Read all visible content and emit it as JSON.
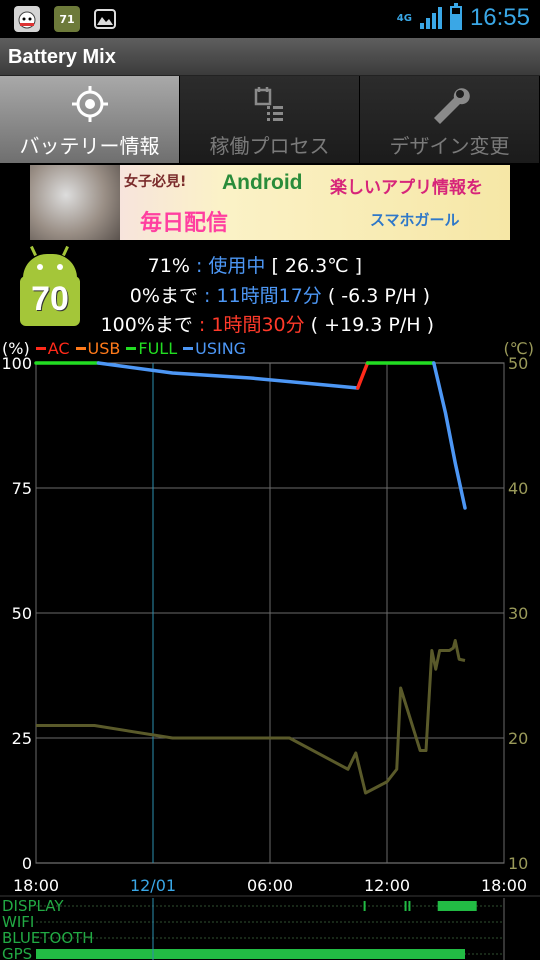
{
  "status_bar": {
    "time": "16:55",
    "network": "4G",
    "notification_badge": "71"
  },
  "app": {
    "title": "Battery Mix"
  },
  "tabs": [
    {
      "label": "バッテリー情報",
      "icon": "target-icon",
      "active": true
    },
    {
      "label": "稼働プロセス",
      "icon": "process-list-icon",
      "active": false
    },
    {
      "label": "デザイン変更",
      "icon": "wrench-icon",
      "active": false
    }
  ],
  "banner": {
    "tag": "女子必見!",
    "main": "Android",
    "main2": "楽しいアプリ情報を",
    "sub": "毎日配信",
    "sub2": "スマホガール"
  },
  "battery": {
    "level": "70",
    "line1": {
      "percent": "71%",
      "sep": " : ",
      "state": "使用中",
      "temp": " [ 26.3℃ ]"
    },
    "line2": {
      "label": "0%まで",
      "sep": " : ",
      "time": "11時間17分",
      "rate": " ( -6.3 P/H )"
    },
    "line3": {
      "label": "100%まで",
      "sep": " : ",
      "time": "1時間30分",
      "rate": " ( +19.3 P/H )"
    }
  },
  "chart_data": {
    "type": "line",
    "left_axis_label": "(%)",
    "right_axis_label": "(℃)",
    "legend": [
      {
        "name": "AC",
        "color": "#ff2a1a"
      },
      {
        "name": "USB",
        "color": "#ff7a1a"
      },
      {
        "name": "FULL",
        "color": "#22dd22"
      },
      {
        "name": "USING",
        "color": "#4d97f5"
      }
    ],
    "y_left_ticks": [
      "100",
      "75",
      "50",
      "25",
      "0"
    ],
    "y_right_ticks": [
      "50",
      "40",
      "30",
      "20",
      "10"
    ],
    "ylim_left": [
      0,
      100
    ],
    "ylim_right": [
      10,
      50
    ],
    "x_ticks": [
      "18:00",
      "12/01",
      "06:00",
      "12:00",
      "18:00"
    ],
    "x_ticks_hours": [
      0,
      6,
      12,
      18,
      24
    ],
    "xlim_hours": [
      0,
      24
    ],
    "battery_series": [
      {
        "state": "FULL",
        "color": "#22dd22",
        "points": [
          [
            0,
            100
          ],
          [
            3.2,
            100
          ]
        ]
      },
      {
        "state": "USING",
        "color": "#4d97f5",
        "points": [
          [
            3.2,
            100
          ],
          [
            7.0,
            98
          ],
          [
            11.0,
            97
          ],
          [
            16.5,
            95
          ]
        ]
      },
      {
        "state": "AC",
        "color": "#ff2a1a",
        "points": [
          [
            16.5,
            95
          ],
          [
            17.0,
            100
          ]
        ]
      },
      {
        "state": "FULL",
        "color": "#22dd22",
        "points": [
          [
            17.0,
            100
          ],
          [
            20.4,
            100
          ]
        ]
      },
      {
        "state": "USING",
        "color": "#4d97f5",
        "points": [
          [
            20.4,
            100
          ],
          [
            21.0,
            90
          ],
          [
            21.5,
            80
          ],
          [
            22.0,
            71
          ]
        ]
      }
    ],
    "temperature_series": {
      "color": "#5a5a2a",
      "points": [
        [
          0,
          21
        ],
        [
          3.0,
          21
        ],
        [
          7.0,
          20.0
        ],
        [
          13.0,
          20.0
        ],
        [
          16.0,
          17.5
        ],
        [
          16.4,
          18.8
        ],
        [
          16.9,
          15.6
        ],
        [
          18.0,
          16.5
        ],
        [
          18.5,
          17.5
        ],
        [
          18.7,
          24.0
        ],
        [
          19.7,
          19.0
        ],
        [
          20.0,
          19.0
        ],
        [
          20.3,
          27.0
        ],
        [
          20.5,
          25.5
        ],
        [
          20.7,
          27.0
        ],
        [
          21.0,
          27.0
        ],
        [
          21.2,
          27.0
        ],
        [
          21.4,
          27.2
        ],
        [
          21.5,
          27.8
        ],
        [
          21.7,
          26.3
        ],
        [
          22.0,
          26.2
        ]
      ]
    },
    "activity_rows": [
      {
        "name": "DISPLAY",
        "segments": [
          [
            16.8,
            16.85
          ],
          [
            18.9,
            18.95
          ],
          [
            19.1,
            19.15
          ],
          [
            20.6,
            22.6
          ]
        ]
      },
      {
        "name": "WIFI",
        "segments": []
      },
      {
        "name": "BLUETOOTH",
        "segments": []
      },
      {
        "name": "GPS",
        "segments": [
          [
            0,
            22.0
          ]
        ]
      }
    ],
    "grid": true
  }
}
